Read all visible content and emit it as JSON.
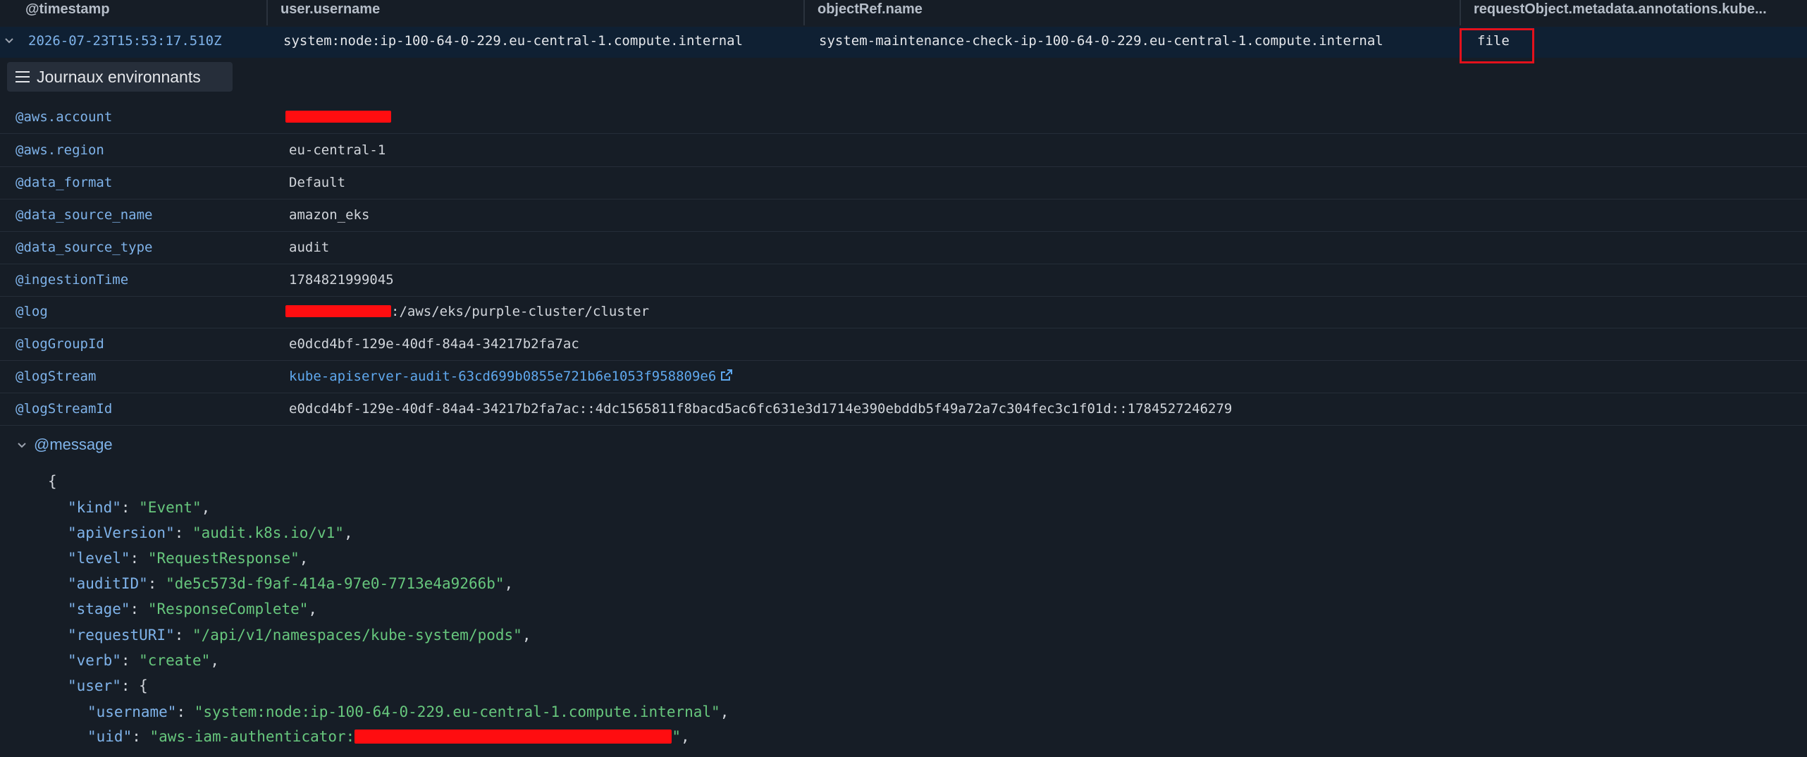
{
  "columns": [
    {
      "label": "@timestamp"
    },
    {
      "label": "user.username"
    },
    {
      "label": "objectRef.name"
    },
    {
      "label": "requestObject.metadata.annotations.kube..."
    }
  ],
  "row": {
    "timestamp": "2026-07-23T15:53:17.510Z",
    "username": "system:node:ip-100-64-0-229.eu-central-1.compute.internal",
    "object_name": "system-maintenance-check-ip-100-64-0-229.eu-central-1.compute.internal",
    "annotation": "file"
  },
  "journaux_button": "Journaux environnants",
  "fields": [
    {
      "key": "@aws.account",
      "value": ""
    },
    {
      "key": "@aws.region",
      "value": "eu-central-1"
    },
    {
      "key": "@data_format",
      "value": "Default"
    },
    {
      "key": "@data_source_name",
      "value": "amazon_eks"
    },
    {
      "key": "@data_source_type",
      "value": "audit"
    },
    {
      "key": "@ingestionTime",
      "value": "1784821999045"
    },
    {
      "key": "@log",
      "value": ":/aws/eks/purple-cluster/cluster"
    },
    {
      "key": "@logGroupId",
      "value": "e0dcd4bf-129e-40df-84a4-34217b2fa7ac"
    },
    {
      "key": "@logStream",
      "value": "kube-apiserver-audit-63cd699b0855e721b6e1053f958809e6"
    },
    {
      "key": "@logStreamId",
      "value": "e0dcd4bf-129e-40df-84a4-34217b2fa7ac::4dc1565811f8bacd5ac6fc631e3d1714e390ebddb5f49a72a7c304fec3c1f01d::1784527246279"
    }
  ],
  "message": {
    "label": "@message",
    "open_brace": "{",
    "kind_key": "\"kind\"",
    "kind_val": "\"Event\"",
    "apiVersion_key": "\"apiVersion\"",
    "apiVersion_val": "\"audit.k8s.io/v1\"",
    "level_key": "\"level\"",
    "level_val": "\"RequestResponse\"",
    "auditID_key": "\"auditID\"",
    "auditID_val": "\"de5c573d-f9af-414a-97e0-7713e4a9266b\"",
    "stage_key": "\"stage\"",
    "stage_val": "\"ResponseComplete\"",
    "requestURI_key": "\"requestURI\"",
    "requestURI_val": "\"/api/v1/namespaces/kube-system/pods\"",
    "verb_key": "\"verb\"",
    "verb_val": "\"create\"",
    "user_key": "\"user\"",
    "user_open": "{",
    "user_username_key": "\"username\"",
    "user_username_val": "\"system:node:ip-100-64-0-229.eu-central-1.compute.internal\"",
    "user_uid_key": "\"uid\"",
    "user_uid_val": "\"aws-iam-authenticator:"
  }
}
